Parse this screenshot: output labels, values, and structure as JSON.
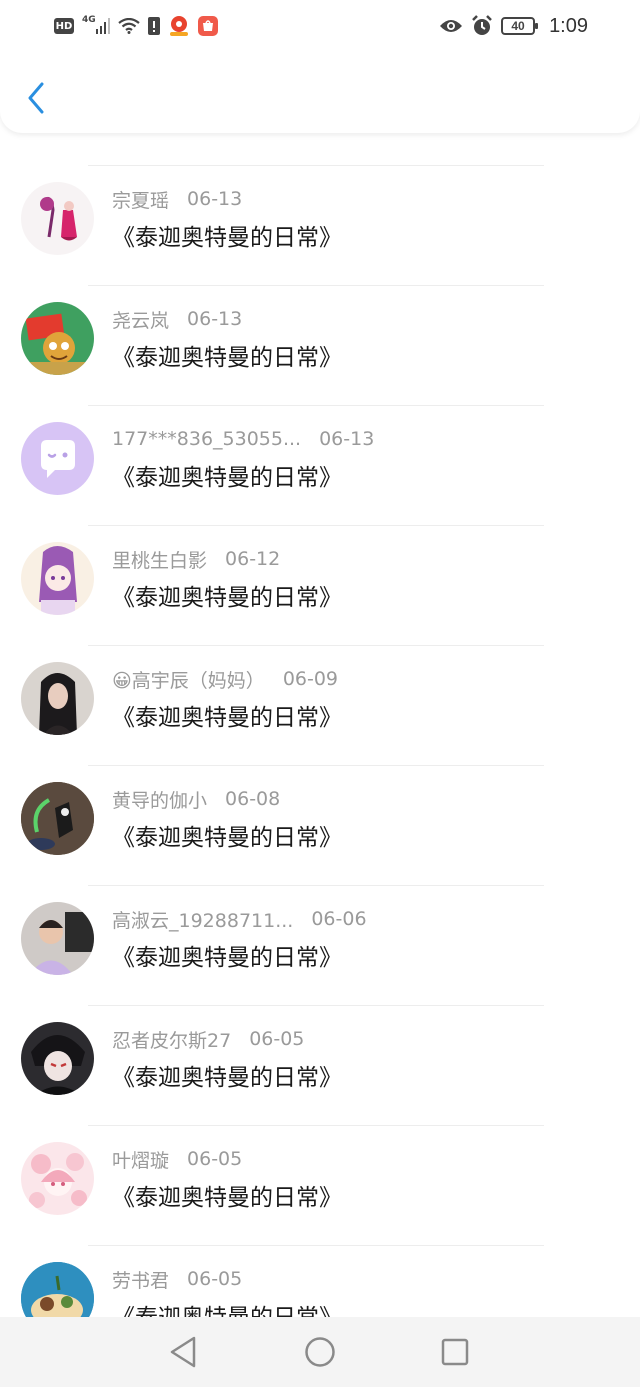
{
  "status_bar": {
    "hd": "HD",
    "network": "4G",
    "time": "1:09",
    "battery": "40",
    "icons": [
      "hd-badge",
      "signal-icon",
      "wifi-icon",
      "alert-icon",
      "map-app-icon",
      "shop-app-icon",
      "eye-icon",
      "alarm-icon",
      "battery-icon"
    ]
  },
  "header": {
    "back_icon": "chevron-left-icon",
    "accent": "#2a8fe0"
  },
  "items": [
    {
      "name": "",
      "date": "",
      "title": ""
    },
    {
      "name": "宗夏瑶",
      "date": "06-13",
      "title": "《泰迦奥特曼的日常》"
    },
    {
      "name": "尧云岚",
      "date": "06-13",
      "title": "《泰迦奥特曼的日常》"
    },
    {
      "name": "177***836_53055...",
      "date": "06-13",
      "title": "《泰迦奥特曼的日常》"
    },
    {
      "name": "里桃生白影",
      "date": "06-12",
      "title": "《泰迦奥特曼的日常》"
    },
    {
      "name": "😀高宇辰（妈妈）",
      "date": "06-09",
      "title": "《泰迦奥特曼的日常》"
    },
    {
      "name": "黄导的伽小",
      "date": "06-08",
      "title": "《泰迦奥特曼的日常》"
    },
    {
      "name": "高淑云_19288711...",
      "date": "06-06",
      "title": "《泰迦奥特曼的日常》"
    },
    {
      "name": "忍者皮尔斯27",
      "date": "06-05",
      "title": "《泰迦奥特曼的日常》"
    },
    {
      "name": "叶熠璇",
      "date": "06-05",
      "title": "《泰迦奥特曼的日常》"
    },
    {
      "name": "劳书君",
      "date": "06-05",
      "title": "《泰迦奥特曼的日常》"
    }
  ],
  "nav": {
    "icons": [
      "back-triangle-icon",
      "home-circle-icon",
      "recents-square-icon"
    ]
  }
}
